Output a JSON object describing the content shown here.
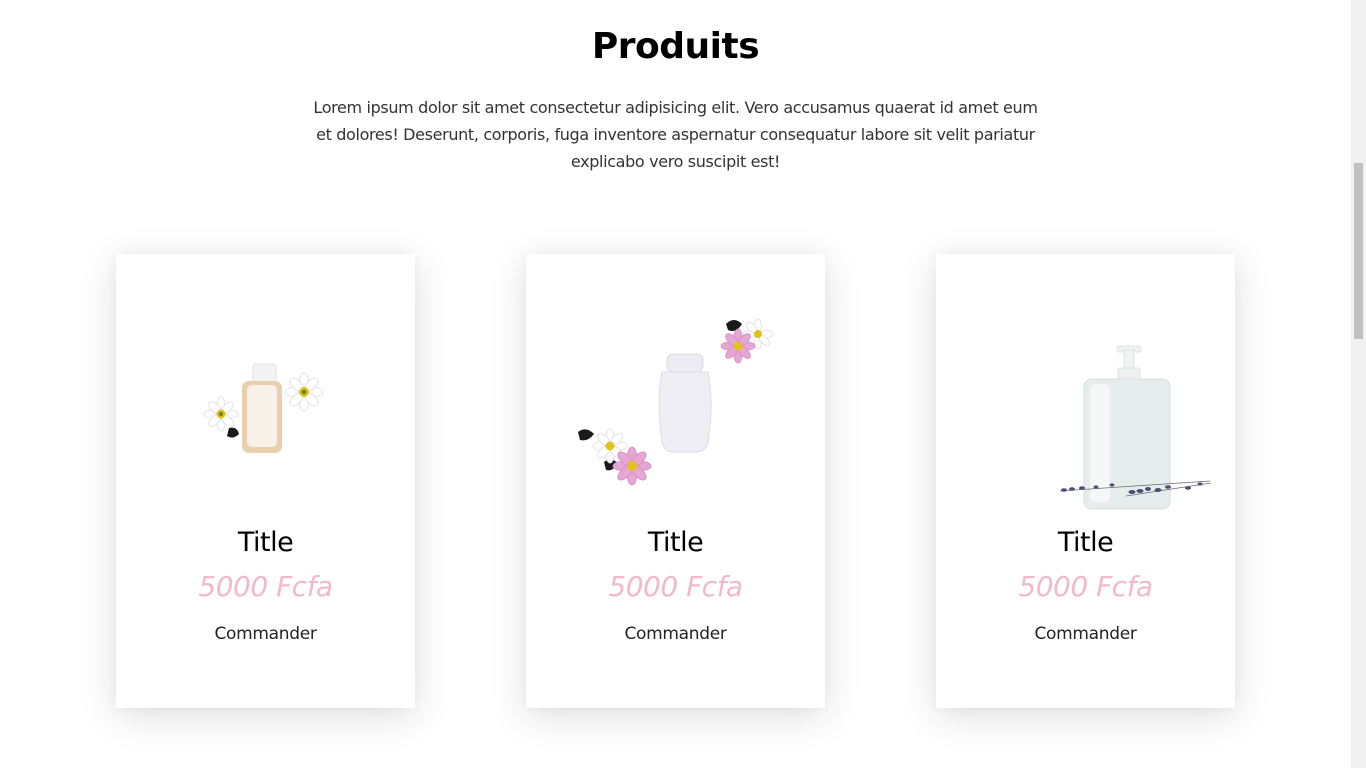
{
  "section": {
    "title": "Produits",
    "description": "Lorem ipsum dolor sit amet consectetur adipisicing elit. Vero accusamus quaerat id amet eum et dolores! Deserunt, corporis, fuga inventore aspernatur consequatur labore sit velit pariatur explicabo vero suscipit est!"
  },
  "products": [
    {
      "title": "Title",
      "price": "5000 Fcfa",
      "cta": "Commander",
      "image": "bottle-with-daisies"
    },
    {
      "title": "Title",
      "price": "5000 Fcfa",
      "cta": "Commander",
      "image": "white-bottle-with-pink-flowers"
    },
    {
      "title": "Title",
      "price": "5000 Fcfa",
      "cta": "Commander",
      "image": "pump-dispenser-with-lavender"
    }
  ],
  "colors": {
    "price": "#f2b9cb",
    "background": "#ffffff"
  }
}
